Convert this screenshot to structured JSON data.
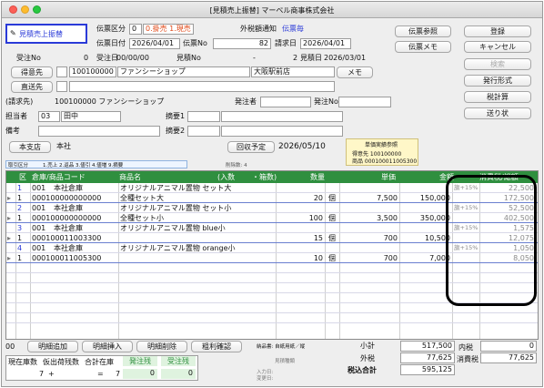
{
  "window": {
    "title": "[見積売上振替] マーベル商事株式会社"
  },
  "header": {
    "tag_label": "見積売上振替",
    "denpyo_kubun_label": "伝票区分",
    "denpyo_kubun_value": "0",
    "kubun_options": "0.掛売 1.現売",
    "tax_notice_label": "外税額通知",
    "tax_notice_value": "伝票毎",
    "denpyo_date_label": "伝票日付",
    "denpyo_date_value": "2026/04/01",
    "denpyo_no_label": "伝票No",
    "denpyo_no_value": "82",
    "seikyu_label": "請求日",
    "seikyu_value": "2026/04/01",
    "juchu_no_label": "受注No",
    "juchu_no_value": "0",
    "juchu_date_label": "受注日",
    "juchu_date_value": "00/00/00",
    "mitsumori_no_label": "見積No",
    "mitsumori_no_value": "-",
    "mitsumori_no_num": "2",
    "mitsumori_date_label": "見積日",
    "mitsumori_date_value": "2026/03/01",
    "tokuisaki_button": "得意先",
    "tokuisaki_code": "100100000",
    "tokuisaki_name": "ファンシーショップ",
    "tokuisaki_branch": "大阪駅前店",
    "memo_button": "メモ",
    "chokuso_button": "直送先",
    "seikyusaki_label": "(請求先)",
    "seikyusaki_value": "100100000 ファンシーショップ",
    "hacchusha_label": "発注者",
    "hacchu_no_label": "発注No",
    "tanto_label": "担当者",
    "tanto_code": "03",
    "tanto_name": "田中",
    "tekiyo1_label": "摘要1",
    "biko_label": "備考",
    "tekiyo2_label": "摘要2",
    "honten_button": "本支店",
    "honten_value": "本社",
    "kaishu_label": "回収予定",
    "kaishu_value": "2026/05/10",
    "tanka_title": "単価実績参照",
    "tanka_tokuisaki": "得意先 100100000",
    "tanka_shohin": "商品 000100011005300",
    "torihiki_label": "取引区分",
    "torihiki_options": "1.売上  2.返品  3.値引  4.値増  9.摘要",
    "sakujo_label": "削除数: 4"
  },
  "right_buttons": {
    "denpyo_sansho": "伝票参照",
    "toroku": "登録",
    "denpyo_memo": "伝票メモ",
    "cancel": "キャンセル",
    "kensaku": "検索",
    "hakko": "発行形式",
    "zei_keisan": "税計算",
    "okurijo": "送り状"
  },
  "grid": {
    "headers": {
      "ku": "区",
      "soko": "倉庫/商品コード",
      "shohin": "商品名",
      "iri": "(入数",
      "hako": "・箱数)",
      "suryo": "数量",
      "tanka": "単価",
      "kingaku": "金額",
      "shohizei": "消費税/総額"
    },
    "items": [
      {
        "no": "1",
        "soko_code": "001",
        "soko_name": "本社倉庫",
        "name1": "オリジナルアニマル置物 セット大",
        "code": "000100000000000",
        "name2": "全種セット大",
        "qty": "20",
        "unit": "個",
        "price": "7,500",
        "amount": "150,000",
        "tax_rate": "旗+15%",
        "tax": "22,500",
        "total": "172,500"
      },
      {
        "no": "2",
        "soko_code": "001",
        "soko_name": "本社倉庫",
        "name1": "オリジナルアニマル置物 セット小",
        "code": "000100000000000",
        "name2": "全種セット小",
        "qty": "100",
        "unit": "個",
        "price": "3,500",
        "amount": "350,000",
        "tax_rate": "旗+15%",
        "tax": "52,500",
        "total": "402,500"
      },
      {
        "no": "3",
        "soko_code": "001",
        "soko_name": "本社倉庫",
        "name1": "オリジナルアニマル置物 blue小",
        "code": "000100011003300",
        "name2": "",
        "qty": "15",
        "unit": "個",
        "price": "700",
        "amount": "10,500",
        "tax_rate": "旗+15%",
        "tax": "1,575",
        "total": "12,075"
      },
      {
        "no": "4",
        "soko_code": "001",
        "soko_name": "本社倉庫",
        "name1": "オリジナルアニマル置物 orange小",
        "code": "000100011005300",
        "name2": "",
        "qty": "10",
        "unit": "個",
        "price": "700",
        "amount": "7,000",
        "tax_rate": "旗+15%",
        "tax": "1,050",
        "total": "8,050"
      }
    ]
  },
  "footer": {
    "row_count": "00",
    "meisai_tsuika": "明細追加",
    "meisai_sonyu": "明細挿入",
    "meisai_sakujo": "明細削除",
    "arari_kakunin": "粗利確認",
    "nohin_label": "納品書: 自紙用紙／縦",
    "mitsumori_label": "見積種類",
    "genzai_zaiko": "現在庫数",
    "karishuka": "仮出荷残数",
    "gokei_zaiko": "合計在庫",
    "hacchu_zan": "発注残",
    "juchu_zan": "受注残",
    "zaiko_value": "7",
    "plus": "+",
    "eq": "=",
    "gokei_value": "7",
    "hacchu_value": "0",
    "juchu_value": "0",
    "nyuryoku_label": "入力日:",
    "henko_label": "変更日:",
    "shokei_label": "小計",
    "shokei_value": "517,500",
    "sotozei_label": "外税",
    "sotozei_value": "77,625",
    "zeikomi_label": "税込合計",
    "zeikomi_value": "595,125",
    "uchizei_label": "内税",
    "uchizei_value": "0",
    "shohizei_label": "消費税",
    "shohizei_value": "77,625"
  },
  "colors": {
    "header_green": "#2f8f3f",
    "accent_blue": "#2a3ad8",
    "circle": "#000000"
  }
}
